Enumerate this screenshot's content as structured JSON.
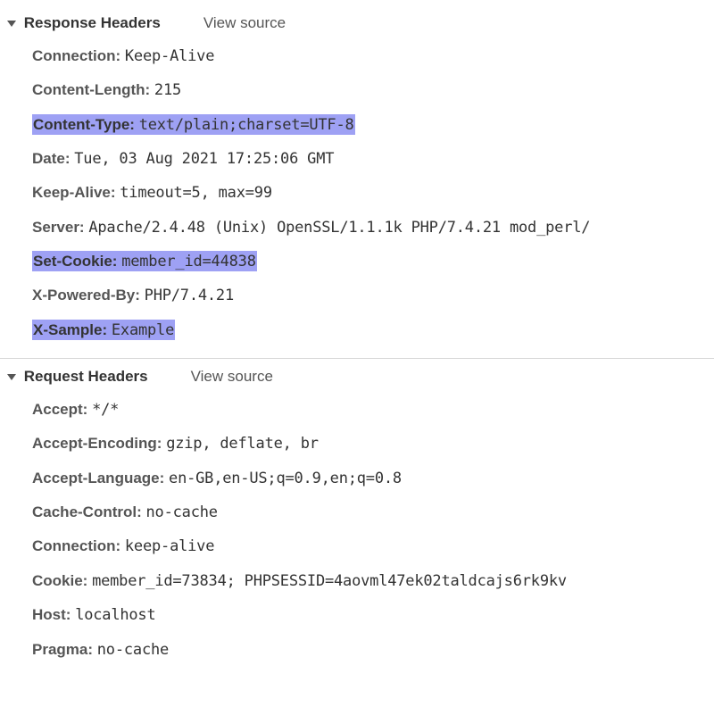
{
  "response": {
    "title": "Response Headers",
    "view_source": "View source",
    "headers": [
      {
        "name": "Connection:",
        "value": "Keep-Alive",
        "highlighted": false
      },
      {
        "name": "Content-Length:",
        "value": "215",
        "highlighted": false
      },
      {
        "name": "Content-Type:",
        "value": "text/plain;charset=UTF-8",
        "highlighted": true
      },
      {
        "name": "Date:",
        "value": "Tue, 03 Aug 2021 17:25:06 GMT",
        "highlighted": false
      },
      {
        "name": "Keep-Alive:",
        "value": "timeout=5, max=99",
        "highlighted": false
      },
      {
        "name": "Server:",
        "value": "Apache/2.4.48 (Unix) OpenSSL/1.1.1k PHP/7.4.21 mod_perl/",
        "highlighted": false
      },
      {
        "name": "Set-Cookie:",
        "value": "member_id=44838",
        "highlighted": true
      },
      {
        "name": "X-Powered-By:",
        "value": "PHP/7.4.21",
        "highlighted": false
      },
      {
        "name": "X-Sample:",
        "value": "Example",
        "highlighted": true
      }
    ]
  },
  "request": {
    "title": "Request Headers",
    "view_source": "View source",
    "headers": [
      {
        "name": "Accept:",
        "value": "*/*",
        "highlighted": false
      },
      {
        "name": "Accept-Encoding:",
        "value": "gzip, deflate, br",
        "highlighted": false
      },
      {
        "name": "Accept-Language:",
        "value": "en-GB,en-US;q=0.9,en;q=0.8",
        "highlighted": false
      },
      {
        "name": "Cache-Control:",
        "value": "no-cache",
        "highlighted": false
      },
      {
        "name": "Connection:",
        "value": "keep-alive",
        "highlighted": false
      },
      {
        "name": "Cookie:",
        "value": "member_id=73834; PHPSESSID=4aovml47ek02taldcajs6rk9kv",
        "highlighted": false
      },
      {
        "name": "Host:",
        "value": "localhost",
        "highlighted": false
      },
      {
        "name": "Pragma:",
        "value": "no-cache",
        "highlighted": false
      }
    ]
  }
}
